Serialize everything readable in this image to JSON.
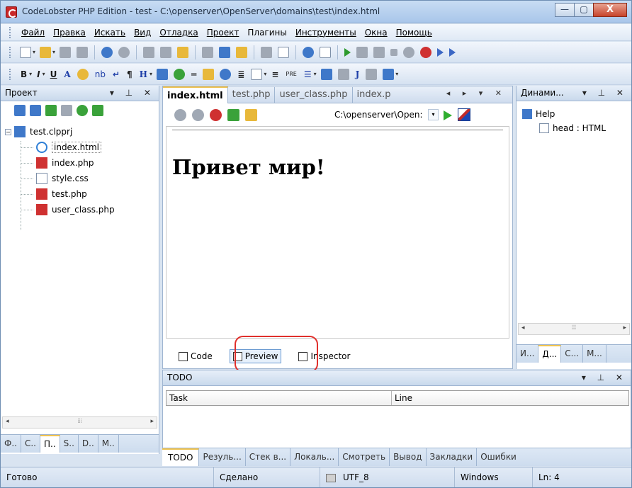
{
  "window": {
    "title": "CodeLobster PHP Edition - test - C:\\openserver\\OpenServer\\domains\\test\\index.html",
    "minimize_glyph": "—",
    "maximize_glyph": "▢",
    "close_glyph": "X"
  },
  "menu": [
    "Файл",
    "Правка",
    "Искать",
    "Вид",
    "Отладка",
    "Проект",
    "Плагины",
    "Инструменты",
    "Окна",
    "Помощь"
  ],
  "toolbar2_glyphs": {
    "bold": "B",
    "italic": "I",
    "underline": "U",
    "font_a": "A",
    "nb": "nb",
    "pilcrow": "¶",
    "heading": "H",
    "pre": "PRE",
    "j": "J"
  },
  "project_panel": {
    "title": "Проект",
    "controls": "▾ ⊥ ✕",
    "project_name": "test.clpprj",
    "expander": "−",
    "files": [
      "index.html",
      "index.php",
      "style.css",
      "test.php",
      "user_class.php"
    ],
    "selected_file": "index.html",
    "bottom_tabs": [
      "Ф..",
      "С..",
      "П..",
      "S..",
      "D..",
      "М.."
    ],
    "active_bottom_tab": "П.."
  },
  "editor": {
    "doc_tabs": [
      "index.html",
      "test.php",
      "user_class.php",
      "index.p"
    ],
    "active_doc_tab": "index.html",
    "doc_nav": "◂ ▸ ▾ ✕",
    "url": "C:\\openserver\\Open:",
    "url_drop": "▾",
    "preview_heading": "Привет мир!",
    "view_tabs": [
      "Code",
      "Preview",
      "Inspector"
    ],
    "active_view_tab": "Preview"
  },
  "right_panel": {
    "title": "Динами...",
    "controls": "▾ ⊥ ✕",
    "tree_root": "Help",
    "tree_child": "head : HTML",
    "scroll_left": "◂",
    "scroll_right": "▸",
    "scroll_grip": "⦙⦙⦙",
    "bottom_tabs": [
      "И...",
      "Д...",
      "С...",
      "М..."
    ],
    "active_bottom_tab": "Д..."
  },
  "todo_panel": {
    "title": "TODO",
    "controls": "▾ ⊥ ✕",
    "columns": [
      "Task",
      "Line"
    ],
    "bottom_tabs": [
      "TODO",
      "Резуль...",
      "Стек в...",
      "Локаль...",
      "Смотреть",
      "Вывод",
      "Закладки",
      "Ошибки"
    ],
    "active_bottom_tab": "TODO"
  },
  "left_scroll": {
    "left": "◂",
    "right": "▸",
    "grip": "⦙⦙⦙"
  },
  "statusbar": {
    "status": "Готово",
    "done": "Сделано",
    "encoding": "UTF_8",
    "line_endings": "Windows",
    "line": "Ln: 4"
  },
  "colors": {
    "accent_red": "#e0302c",
    "tab_highlight": "#f0c350"
  }
}
